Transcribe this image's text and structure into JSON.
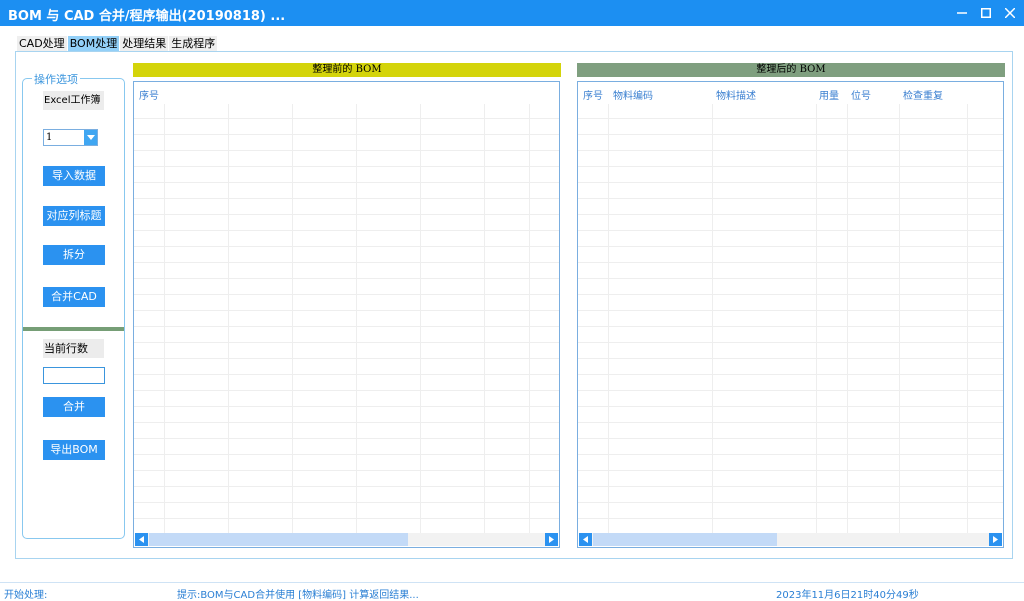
{
  "window": {
    "title": "BOM 与 CAD 合并/程序输出(20190818) ..."
  },
  "tabs": [
    {
      "label": "CAD处理",
      "active": false
    },
    {
      "label": "BOM处理",
      "active": true
    },
    {
      "label": "处理结果",
      "active": false
    },
    {
      "label": "生成程序",
      "active": false
    }
  ],
  "options": {
    "group_title": "操作选项",
    "workbook_label": "Excel工作簿",
    "workbook_value": "1",
    "import_button": "导入数据",
    "map_columns_button": "对应列标题",
    "split_button": "拆分",
    "merge_cad_button": "合并CAD",
    "current_rows_label": "当前行数",
    "current_rows_value": "",
    "merge_button": "合并",
    "export_bom_button": "导出BOM"
  },
  "before_bom": {
    "title": "整理前的 BOM",
    "header_color": "#d4d40a",
    "columns": [
      "序号"
    ]
  },
  "after_bom": {
    "title": "整理后的 BOM",
    "header_color": "#7f9f7f",
    "columns": [
      "序号",
      "物料编码",
      "物料描述",
      "用量",
      "位号",
      "检查重复"
    ]
  },
  "status": {
    "left": "开始处理:",
    "hint": "提示:BOM与CAD合并使用 [物料编码] 计算返回结果...",
    "datetime": "2023年11月6日21时40分49秒"
  }
}
